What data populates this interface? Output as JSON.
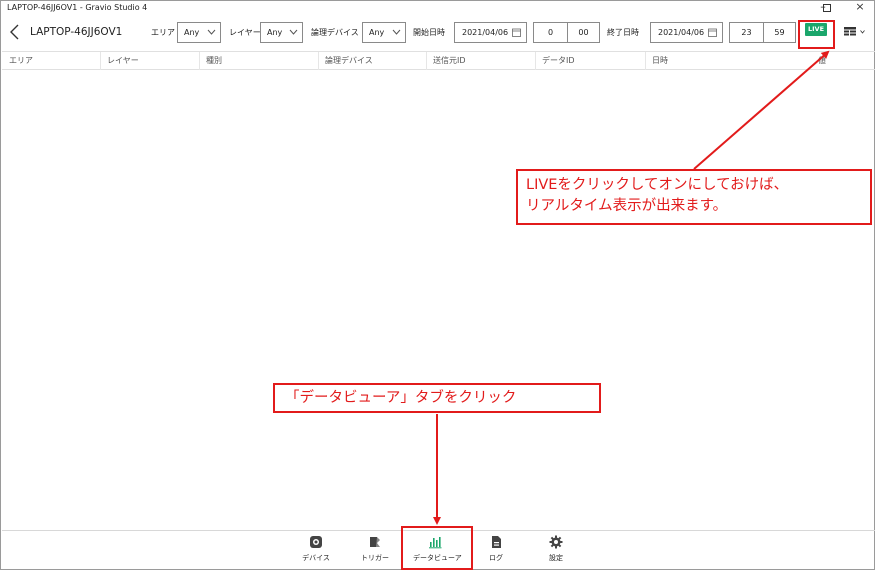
{
  "window": {
    "title": "LAPTOP-46JJ6OV1 - Gravio Studio 4",
    "controls": {
      "minimize": "–",
      "close": "×"
    }
  },
  "toolbar": {
    "device_name": "LAPTOP-46JJ6OV1",
    "area_label": "エリア",
    "area_value": "Any",
    "layer_label": "レイヤー",
    "layer_value": "Any",
    "logical_device_label": "論理デバイス",
    "logical_device_value": "Any",
    "start_label": "開始日時",
    "start_date": "2021/04/06",
    "start_hour": "0",
    "start_minute": "00",
    "end_label": "終了日時",
    "end_date": "2021/04/06",
    "end_hour": "23",
    "end_minute": "59",
    "live_label": "LIVE",
    "live_color": "#1aa66b"
  },
  "table": {
    "columns": [
      "エリア",
      "レイヤー",
      "種別",
      "論理デバイス",
      "送信元ID",
      "データID",
      "日時",
      "値"
    ],
    "rows": []
  },
  "bottom_nav": {
    "items": [
      {
        "label": "デバイス",
        "icon": "device-icon"
      },
      {
        "label": "トリガー",
        "icon": "trigger-icon"
      },
      {
        "label": "データビューア",
        "icon": "chart-icon",
        "active": true
      },
      {
        "label": "ログ",
        "icon": "log-icon"
      },
      {
        "label": "設定",
        "icon": "gear-icon"
      }
    ],
    "active_color": "#1aa66b"
  },
  "annotations": {
    "live_line1": "LIVEをクリックしてオンにしておけば、",
    "live_line2": "リアルタイム表示が出来ます。",
    "tab_hint": "「データビューア」タブをクリック",
    "highlight_color": "#e21b1b"
  }
}
